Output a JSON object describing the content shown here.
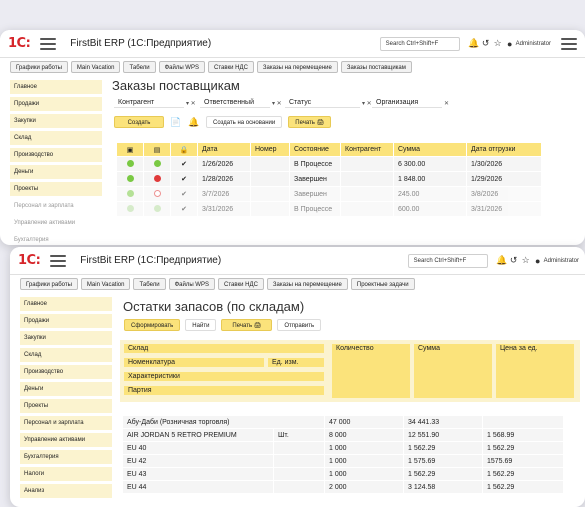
{
  "window1": {
    "app_title": "FirstBit ERP (1С:Предприятие)",
    "logo": "1С:",
    "search_placeholder": "Search Ctrl+Shift+F",
    "user": "Administrator",
    "tabs": [
      "Графики работы",
      "Main Vacation",
      "Табели",
      "Файлы WPS",
      "Ставки НДС",
      "Заказы на перемещение",
      "Заказы поставщикам"
    ],
    "sidebar": [
      "Главное",
      "Продажи",
      "Закупки",
      "Склад",
      "Производство",
      "Деньги",
      "Проекты",
      "Персонал и зарплата",
      "Управление активами",
      "Бухгалтерия"
    ],
    "page_title": "Заказы поставщикам",
    "filters": [
      "Контрагент",
      "Ответственный",
      "Статус",
      "Организация"
    ],
    "buttons": {
      "create": "Создать",
      "create_based": "Создать на основании",
      "print": "Печать"
    },
    "table": {
      "columns": [
        "Дата",
        "Номер",
        "Состояние",
        "Контрагент",
        "Сумма",
        "Дата отгрузки"
      ],
      "rows": [
        {
          "status_color": "#7ac943",
          "second_color": "#7ac943",
          "check": "✔",
          "date": "1/26/2026",
          "number": "",
          "state": "В Процессе",
          "counterparty": "",
          "sum": "6 300.00",
          "ship_date": "1/30/2026",
          "faded": false
        },
        {
          "status_color": "#7ac943",
          "second_color": "#e03a3a",
          "check": "✔",
          "date": "1/28/2026",
          "number": "",
          "state": "Завершен",
          "counterparty": "",
          "sum": "1 848.00",
          "ship_date": "1/29/2026",
          "faded": false
        },
        {
          "status_color": "#7ac943",
          "second_color": "#ffffff",
          "check": "✔",
          "date": "3/7/2026",
          "number": "",
          "state": "Завершен",
          "counterparty": "",
          "sum": "245.00",
          "ship_date": "3/8/2026",
          "faded": true
        },
        {
          "status_color": "#b5dba0",
          "second_color": "#b5dba0",
          "check": "✔",
          "date": "3/31/2026",
          "number": "",
          "state": "В Процессе",
          "counterparty": "",
          "sum": "600.00",
          "ship_date": "3/31/2026",
          "faded": true
        }
      ]
    }
  },
  "window2": {
    "app_title": "FirstBit ERP (1С:Предприятие)",
    "logo": "1С:",
    "search_placeholder": "Search Ctrl+Shift+F",
    "user": "Administrator",
    "tabs": [
      "Графики работы",
      "Main Vacation",
      "Табели",
      "Файлы WPS",
      "Ставки НДС",
      "Заказы на перемещение",
      "Проектные задачи"
    ],
    "sidebar": [
      "Главное",
      "Продажи",
      "Закупки",
      "Склад",
      "Производство",
      "Деньги",
      "Проекты",
      "Персонал и зарплата",
      "Управление активами",
      "Бухгалтерия",
      "Налоги",
      "Анализ"
    ],
    "page_title": "Остатки запасов (по складам)",
    "buttons": {
      "generate": "Сформировать",
      "find": "Найти",
      "print": "Печать",
      "send": "Отправить"
    },
    "report_header": {
      "warehouse": "Склад",
      "nomenclature": "Номенклатура",
      "unit": "Ед. изм.",
      "characteristics": "Характеристики",
      "batch": "Партия",
      "quantity": "Количество",
      "sum": "Сумма",
      "price": "Цена за ед."
    },
    "rows": [
      {
        "name": "Абу-Даби (Розничная торговля)",
        "unit": "",
        "qty": "47 000",
        "sum": "34 441.33",
        "price": ""
      },
      {
        "name": "AIR JORDAN 5 RETRO PREMIUM",
        "unit": "Шт.",
        "qty": "8 000",
        "sum": "12 551.90",
        "price": "1 568.99"
      },
      {
        "name": "EU 40",
        "unit": "",
        "qty": "1 000",
        "sum": "1 562.29",
        "price": "1 562.29"
      },
      {
        "name": "EU 42",
        "unit": "",
        "qty": "1 000",
        "sum": "1 575.69",
        "price": "1575.69"
      },
      {
        "name": "EU 43",
        "unit": "",
        "qty": "1 000",
        "sum": "1 562.29",
        "price": "1 562.29"
      },
      {
        "name": "EU 44",
        "unit": "",
        "qty": "2 000",
        "sum": "3 124.58",
        "price": "1 562.29"
      }
    ]
  }
}
